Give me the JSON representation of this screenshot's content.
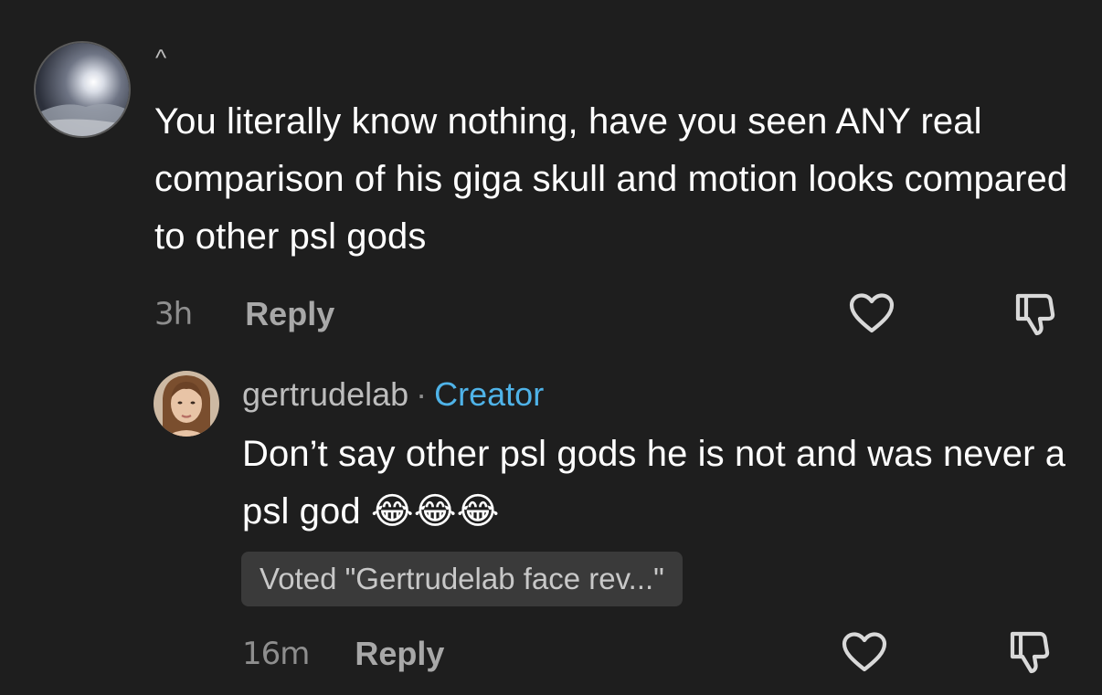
{
  "thread": {
    "parent_comment": {
      "username": "^",
      "text": "You literally know nothing, have you seen ANY real comparison of his giga skull and motion looks compared to other psl gods",
      "timestamp": "3h",
      "reply_label": "Reply",
      "avatar_icon": "dark-night-photo-avatar"
    },
    "reply_comment": {
      "username": "gertrudelab",
      "separator": "·",
      "badge": "Creator",
      "text": "Don’t say other psl gods he is not and was never a psl god 😂😂😂",
      "vote_label": "Voted \"Gertrudelab face rev...\"",
      "timestamp": "16m",
      "reply_label": "Reply",
      "avatar_icon": "woman-portrait-avatar"
    }
  },
  "icons": {
    "like": "heart-outline-icon",
    "dislike": "thumbs-down-outline-icon"
  },
  "colors": {
    "background": "#1e1e1e",
    "text_primary": "#ffffff",
    "text_secondary": "#a8a8a8",
    "creator_accent": "#4fb3e8",
    "vote_pill_bg": "#3a3a3a"
  }
}
